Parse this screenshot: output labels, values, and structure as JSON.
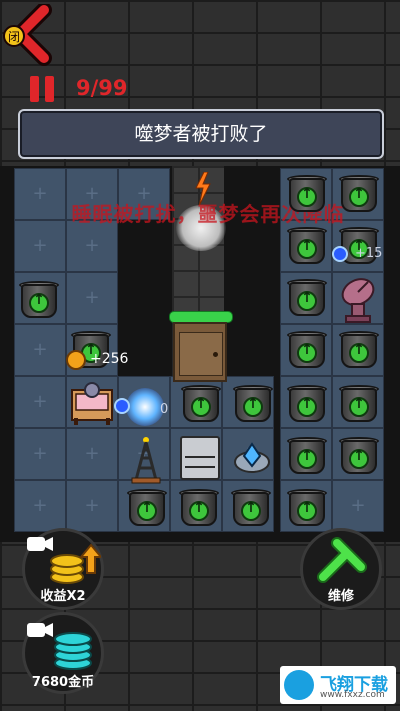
{
  "top": {
    "close_label": "闭",
    "wave": "9/99"
  },
  "notice": "噬梦者被打败了",
  "banner": "睡眠被打扰，噩梦会再次降临",
  "floating": {
    "gold_gain": "+256",
    "gold_gain_2": "+15",
    "damage": "0"
  },
  "buttons": {
    "double_income": "收益X2",
    "repair": "维修",
    "coins": "7680金币"
  },
  "watermark": {
    "title": "飞翔下载",
    "url": "www.fxxz.com"
  },
  "colors": {
    "accent_red": "#e0262a",
    "tile": "#41546a",
    "upgrade_green": "#3ec63c",
    "gold": "#f3a21a"
  }
}
